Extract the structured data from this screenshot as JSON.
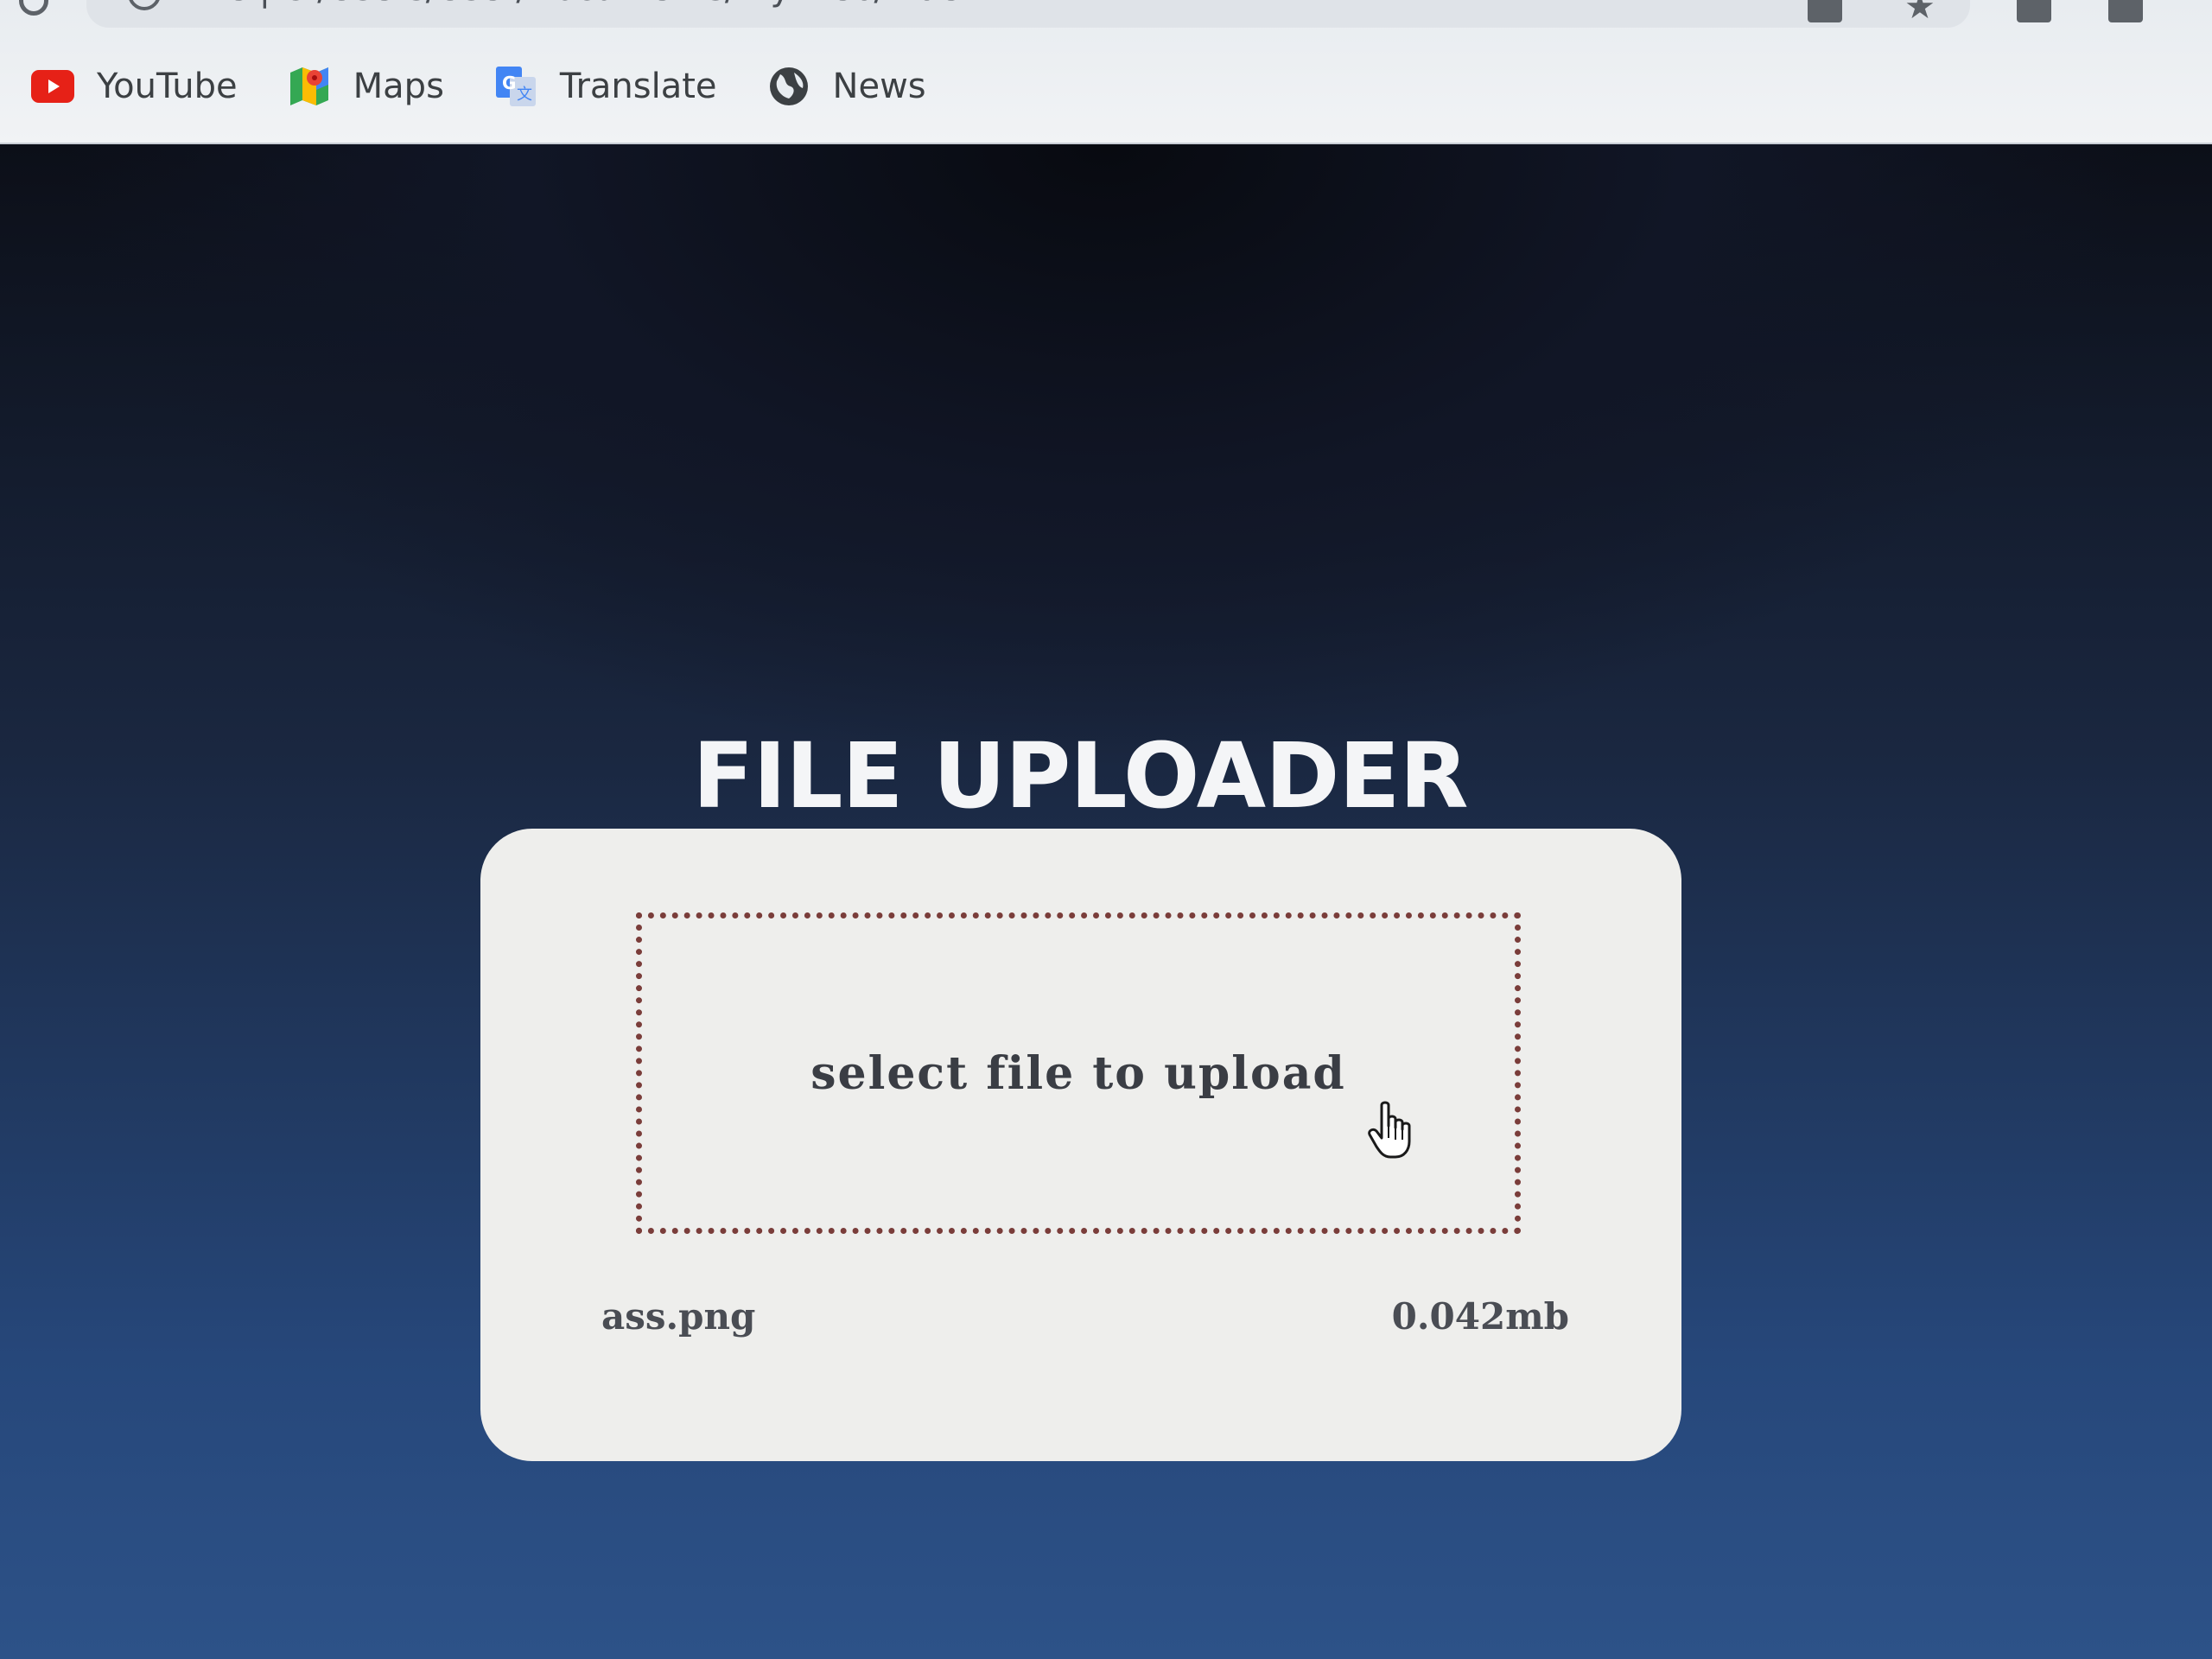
{
  "browser": {
    "url": "C:/Users/User/Documents/my-web/index.html",
    "url_prefix": "File",
    "bookmarks": [
      {
        "label": "YouTube",
        "icon": "youtube-icon"
      },
      {
        "label": "Maps",
        "icon": "maps-icon"
      },
      {
        "label": "Translate",
        "icon": "translate-icon"
      },
      {
        "label": "News",
        "icon": "news-icon"
      }
    ]
  },
  "page": {
    "title": "FILE UPLOADER",
    "dropzone_prompt": "select file to upload",
    "file": {
      "name": "ass.png",
      "size": "0.042mb"
    }
  },
  "colors": {
    "youtube": "#e62117",
    "dropzone_border": "#7a3d3a",
    "card_background": "#eeeeec"
  }
}
